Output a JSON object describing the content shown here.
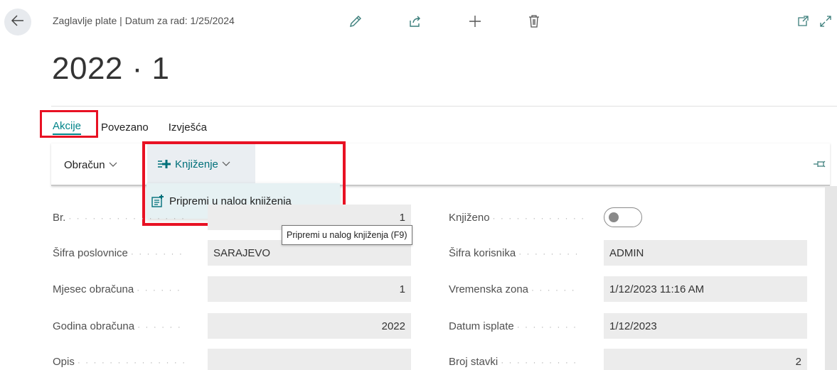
{
  "header": {
    "caption": "Zaglavlje plate | Datum za rad: 1/25/2024",
    "record_title": "2022 · 1",
    "icons": [
      "back-arrow-icon",
      "edit-pencil-icon",
      "share-icon",
      "add-plus-icon",
      "delete-trash-icon",
      "open-new-window-icon",
      "expand-icon"
    ]
  },
  "tabs": [
    {
      "label": "Akcije",
      "active": true
    },
    {
      "label": "Povezano",
      "active": false
    },
    {
      "label": "Izvješća",
      "active": false
    }
  ],
  "action_bar": {
    "obracun_label": "Obračun",
    "knjizenje_label": "Knjiženje"
  },
  "dropdown": {
    "item_label": "Pripremi u nalog knjiženja",
    "tooltip": "Pripremi u nalog knjiženja (F9)"
  },
  "fields_left": [
    {
      "label": "Br.",
      "value": "1"
    },
    {
      "label": "Šifra poslovnice",
      "value": "SARAJEVO"
    },
    {
      "label": "Mjesec obračuna",
      "value": "1"
    },
    {
      "label": "Godina obračuna",
      "value": "2022"
    },
    {
      "label": "Opis",
      "value": ""
    }
  ],
  "fields_right": [
    {
      "label": "Knjiženo",
      "value": false
    },
    {
      "label": "Šifra korisnika",
      "value": "ADMIN"
    },
    {
      "label": "Vremenska zona",
      "value": "1/12/2023 11:16 AM"
    },
    {
      "label": "Datum isplate",
      "value": "1/12/2023"
    },
    {
      "label": "Broj stavki",
      "value": "2"
    }
  ],
  "colors": {
    "accent": "#008489",
    "highlight": "#e81123",
    "field_bg": "#ececec"
  }
}
